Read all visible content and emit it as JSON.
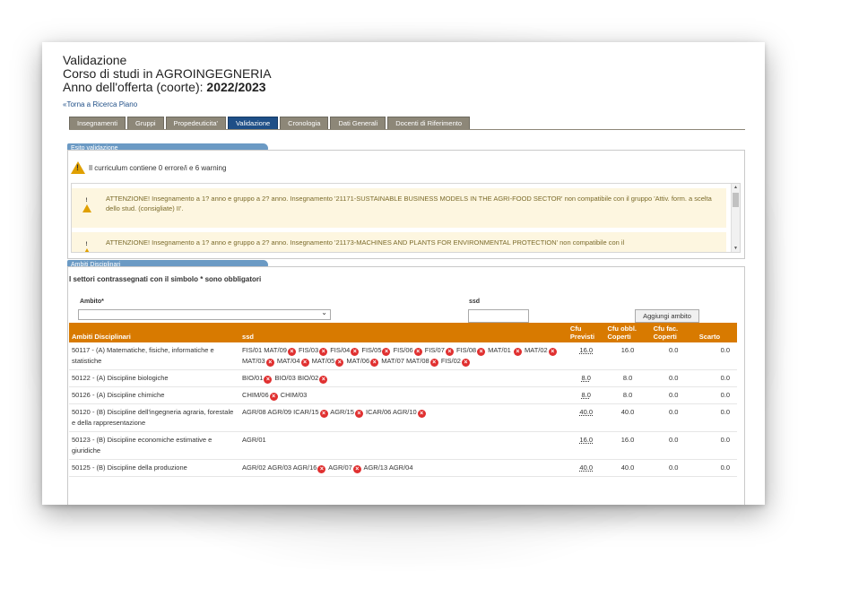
{
  "header": {
    "title": "Validazione",
    "course": "Corso di studi in AGROINGEGNERIA",
    "offer_label": "Anno dell'offerta (coorte): ",
    "offer_year": "2022/2023",
    "back_link": "«Torna a Ricerca Piano"
  },
  "tabs": [
    {
      "label": "Insegnamenti",
      "active": false
    },
    {
      "label": "Gruppi",
      "active": false
    },
    {
      "label": "Propedeuticita'",
      "active": false
    },
    {
      "label": "Validazione",
      "active": true
    },
    {
      "label": "Cronologia",
      "active": false
    },
    {
      "label": "Dati Generali",
      "active": false
    },
    {
      "label": "Docenti di Riferimento",
      "active": false
    }
  ],
  "esito": {
    "section_title": "Esito validazione",
    "summary": "Il curriculum contiene 0 errore/i e 6 warning",
    "warnings": [
      "ATTENZIONE! Insegnamento a 1? anno e gruppo a 2? anno. Insegnamento '21171-SUSTAINABLE BUSINESS MODELS IN THE AGRI-FOOD SECTOR' non compatibile con il gruppo 'Attiv. form. a scelta dello stud. (consigliate) II'.",
      "ATTENZIONE! Insegnamento a 1? anno e gruppo a 2? anno. Insegnamento '21173-MACHINES AND PLANTS FOR ENVIRONMENTAL PROTECTION' non compatibile con il"
    ]
  },
  "ambiti": {
    "section_title": "Ambiti Disciplinari",
    "note": "I settori contrassegnati con il simbolo * sono obbligatori",
    "ambito_label": "Ambito*",
    "ambito_value": "",
    "ssd_label": "ssd",
    "ssd_value": "",
    "add_button": "Aggiungi ambito",
    "columns": {
      "ambito": "Ambiti Disciplinari",
      "ssd": "ssd",
      "cfu_prev": "Cfu Previsti",
      "cfu_obbl": "Cfu obbl. Coperti",
      "cfu_fac": "Cfu fac. Coperti",
      "scarto": "Scarto"
    },
    "rows": [
      {
        "ambito": "50117 - (A) Matematiche, fisiche, informatiche e statistiche",
        "ssd": [
          {
            "code": "FIS/01",
            "x": false
          },
          {
            "code": "MAT/09",
            "x": true
          },
          {
            "code": "FIS/03",
            "x": true
          },
          {
            "code": "FIS/04",
            "x": true
          },
          {
            "code": "FIS/05",
            "x": true
          },
          {
            "code": "FIS/06",
            "x": true
          },
          {
            "code": "FIS/07",
            "x": true
          },
          {
            "code": "FIS/08",
            "x": true
          },
          {
            "code": "MAT/01",
            "x": false
          },
          {
            "code": "",
            "x": true
          },
          {
            "code": "MAT/02",
            "x": true
          },
          {
            "code": "MAT/03",
            "x": true
          },
          {
            "code": "MAT/04",
            "x": true
          },
          {
            "code": "MAT/05",
            "x": true
          },
          {
            "code": "MAT/06",
            "x": true
          },
          {
            "code": "MAT/07",
            "x": false
          },
          {
            "code": "MAT/08",
            "x": true
          },
          {
            "code": "FIS/02",
            "x": true
          }
        ],
        "cfu_prev": "16.0",
        "cfu_obbl": "16.0",
        "cfu_fac": "0.0",
        "scarto": "0.0"
      },
      {
        "ambito": "50122 - (A) Discipline biologiche",
        "ssd": [
          {
            "code": "BIO/01",
            "x": true
          },
          {
            "code": "BIO/03",
            "x": false
          },
          {
            "code": "BIO/02",
            "x": true
          }
        ],
        "cfu_prev": "8.0",
        "cfu_obbl": "8.0",
        "cfu_fac": "0.0",
        "scarto": "0.0"
      },
      {
        "ambito": "50126 - (A) Discipline chimiche",
        "ssd": [
          {
            "code": "CHIM/06",
            "x": true
          },
          {
            "code": "CHIM/03",
            "x": false
          }
        ],
        "cfu_prev": "8.0",
        "cfu_obbl": "8.0",
        "cfu_fac": "0.0",
        "scarto": "0.0"
      },
      {
        "ambito": "50120 - (B) Discipline dell'ingegneria agraria, forestale e della rappresentazione",
        "ssd": [
          {
            "code": "AGR/08",
            "x": false
          },
          {
            "code": "AGR/09",
            "x": false
          },
          {
            "code": "ICAR/15",
            "x": true
          },
          {
            "code": "AGR/15",
            "x": true
          },
          {
            "code": "ICAR/06",
            "x": false
          },
          {
            "code": "AGR/10",
            "x": true
          }
        ],
        "cfu_prev": "40.0",
        "cfu_obbl": "40.0",
        "cfu_fac": "0.0",
        "scarto": "0.0"
      },
      {
        "ambito": "50123 - (B) Discipline economiche estimative e giuridiche",
        "ssd": [
          {
            "code": "AGR/01",
            "x": false
          }
        ],
        "cfu_prev": "16.0",
        "cfu_obbl": "16.0",
        "cfu_fac": "0.0",
        "scarto": "0.0"
      },
      {
        "ambito": "50125 - (B) Discipline della produzione",
        "ssd": [
          {
            "code": "AGR/02",
            "x": false
          },
          {
            "code": "AGR/03",
            "x": false
          },
          {
            "code": "AGR/16",
            "x": true
          },
          {
            "code": "AGR/07",
            "x": true
          },
          {
            "code": "AGR/13",
            "x": false
          },
          {
            "code": "AGR/04",
            "x": false
          }
        ],
        "cfu_prev": "40.0",
        "cfu_obbl": "40.0",
        "cfu_fac": "0.0",
        "scarto": "0.0"
      }
    ]
  }
}
